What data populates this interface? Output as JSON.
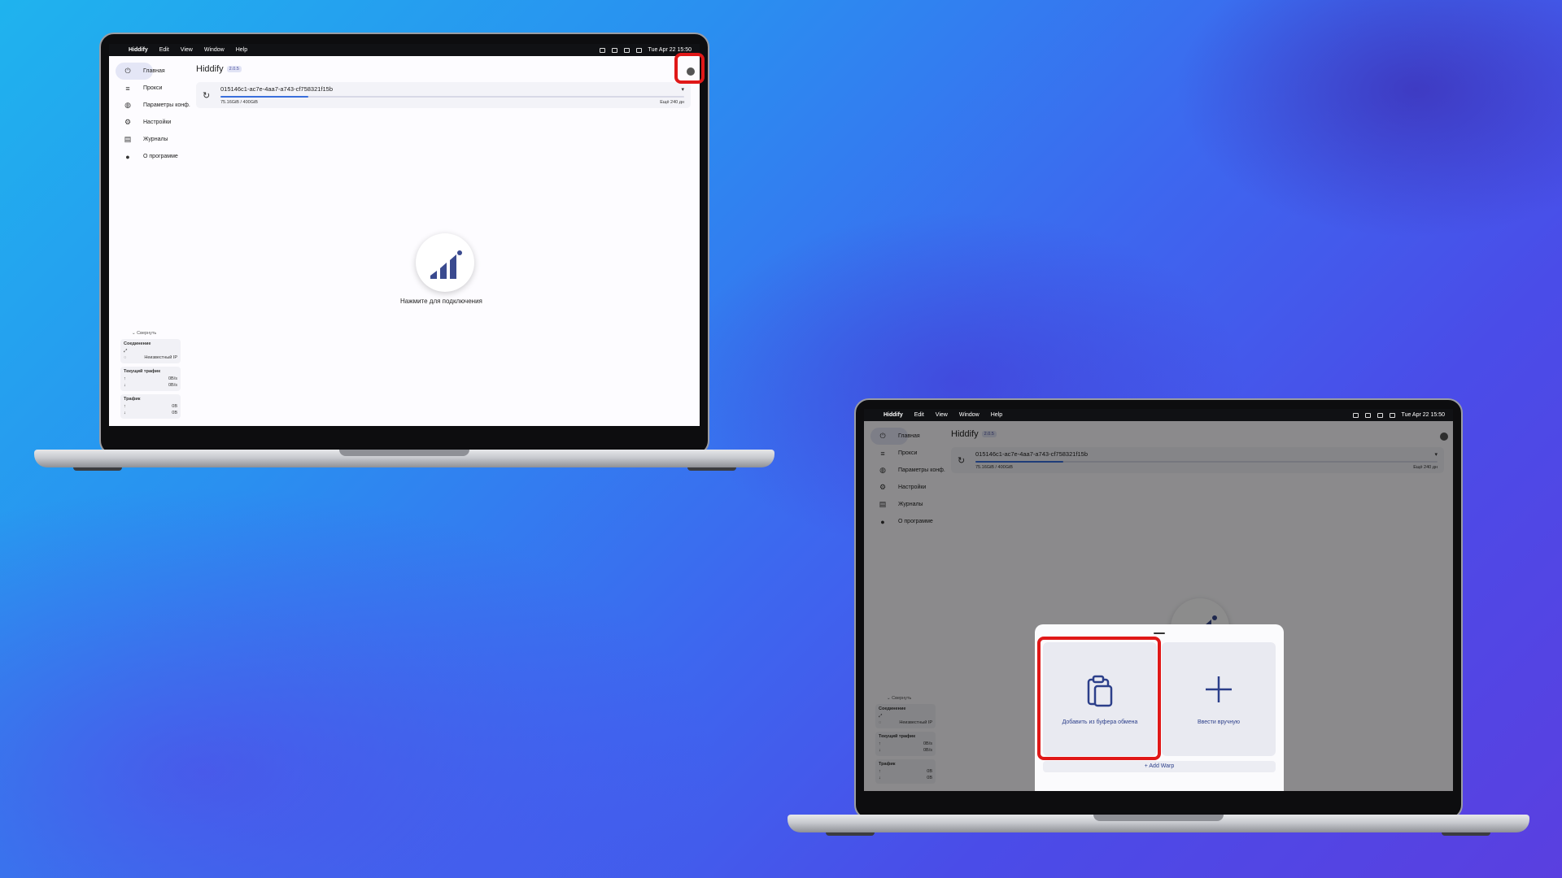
{
  "menubar": {
    "app": "Hiddify",
    "items": [
      "Edit",
      "View",
      "Window",
      "Help"
    ],
    "datetime": "Tue Apr 22  15:50"
  },
  "app": {
    "title": "Hiddify",
    "version": "2.0.5",
    "nav": [
      {
        "label": "Главная",
        "icon": "power-icon"
      },
      {
        "label": "Прокси",
        "icon": "filter-icon"
      },
      {
        "label": "Параметры конф.",
        "icon": "globe-icon"
      },
      {
        "label": "Настройки",
        "icon": "gear-icon"
      },
      {
        "label": "Журналы",
        "icon": "document-icon"
      },
      {
        "label": "О программе",
        "icon": "info-icon"
      }
    ],
    "profile": {
      "name": "015146c1-ac7e-4aa7-a743-cf758321f15b",
      "usage": "75.16GiB / 400GiB",
      "remaining": "Ещё 240 дн",
      "usage_fraction": 0.19
    },
    "connect_label": "Нажмите для подключения",
    "stats": {
      "collapse": "Свернуть",
      "connection_title": "Соединение",
      "unknown_ip": "Неизвестный IP",
      "current_traffic_title": "Текущий трафик",
      "rate_up": "0B/s",
      "rate_down": "0B/s",
      "traffic_title": "Трафик",
      "total_up": "0B",
      "total_down": "0B"
    }
  },
  "sheet": {
    "clipboard_label": "Добавить из буфера обмена",
    "manual_label": "Ввести вручную",
    "warp_label": "Add Warp"
  },
  "colors": {
    "highlight": "#e01818",
    "accent": "#3a6fdc"
  }
}
